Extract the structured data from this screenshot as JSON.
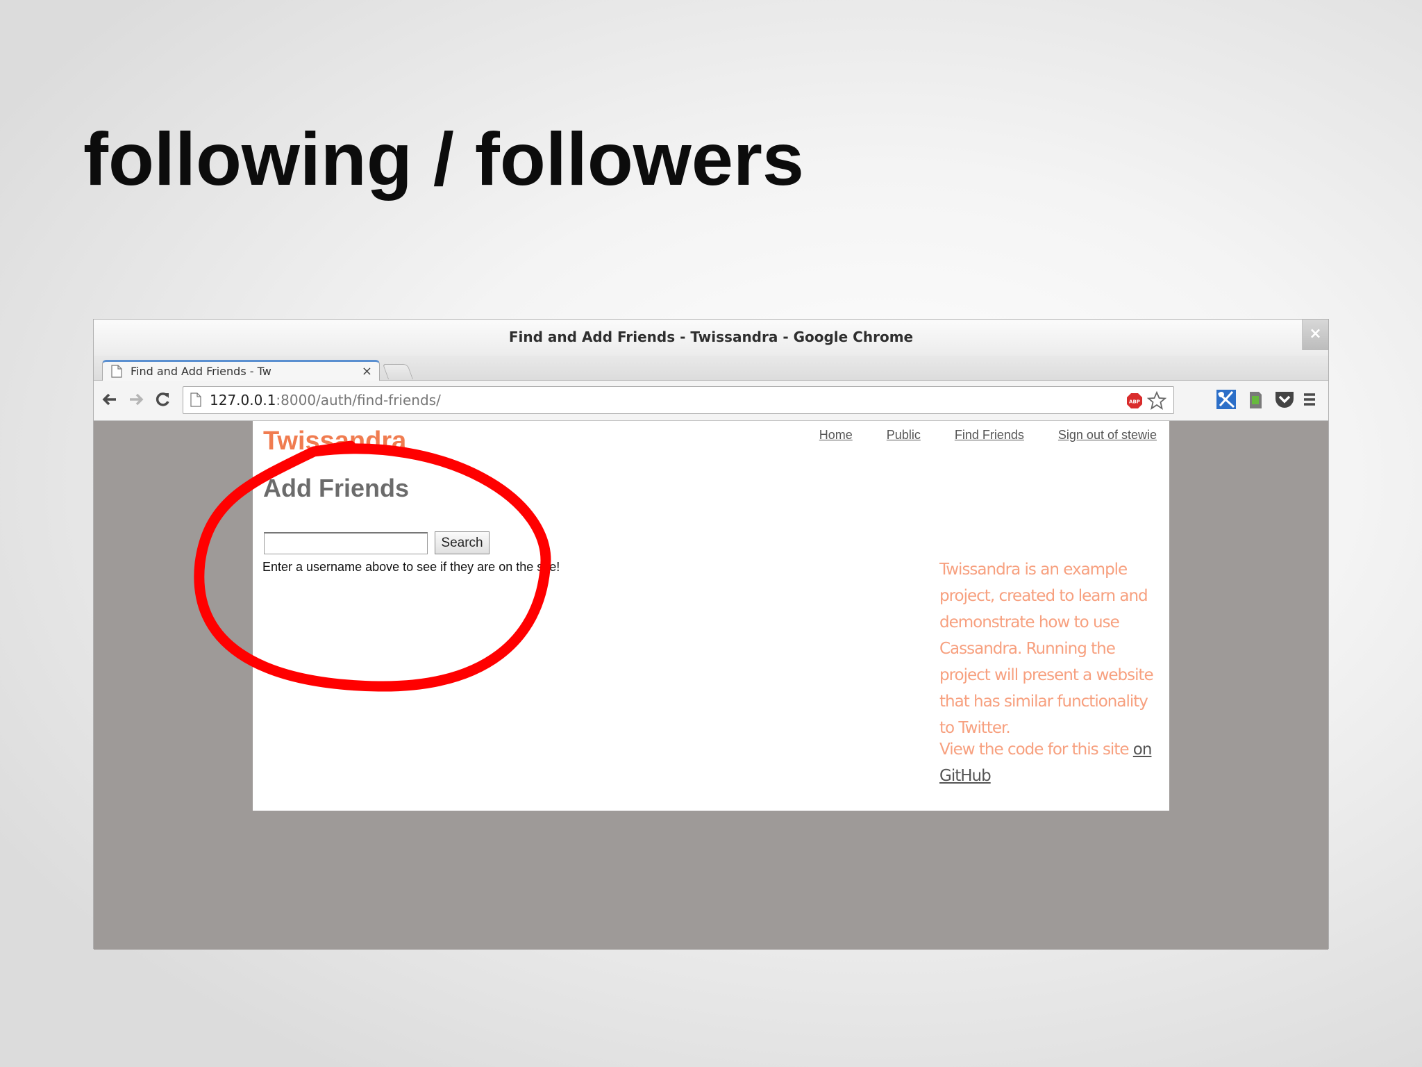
{
  "slide": {
    "title": "following / followers"
  },
  "window": {
    "title": "Find and Add Friends - Twissandra - Google Chrome",
    "close_label": "×"
  },
  "tab": {
    "label": "Find and Add Friends - Tw",
    "close_label": "×"
  },
  "toolbar": {
    "back_icon": "←",
    "forward_icon": "→",
    "reload_icon": "C",
    "url_host": "127.0.0.1",
    "url_path": ":8000/auth/find-friends/",
    "menu_icon": "≡"
  },
  "site": {
    "brand": "Twissandra",
    "nav": [
      "Home",
      "Public",
      "Find Friends",
      "Sign out of stewie"
    ],
    "heading": "Add Friends",
    "search_button": "Search",
    "search_value": "",
    "hint": "Enter a username above to see if they are on the site!",
    "about": "Twissandra is an example project, created to learn and demonstrate how to use Cassandra. Running the project will present a website that has similar functionality to Twitter.",
    "code_prefix": "View the code for this site ",
    "code_link": "on GitHub"
  },
  "colors": {
    "brand": "#f07c50",
    "about_text": "#f7a07f",
    "annotation": "#ff0000",
    "viewport_bg": "#9e9a98"
  }
}
